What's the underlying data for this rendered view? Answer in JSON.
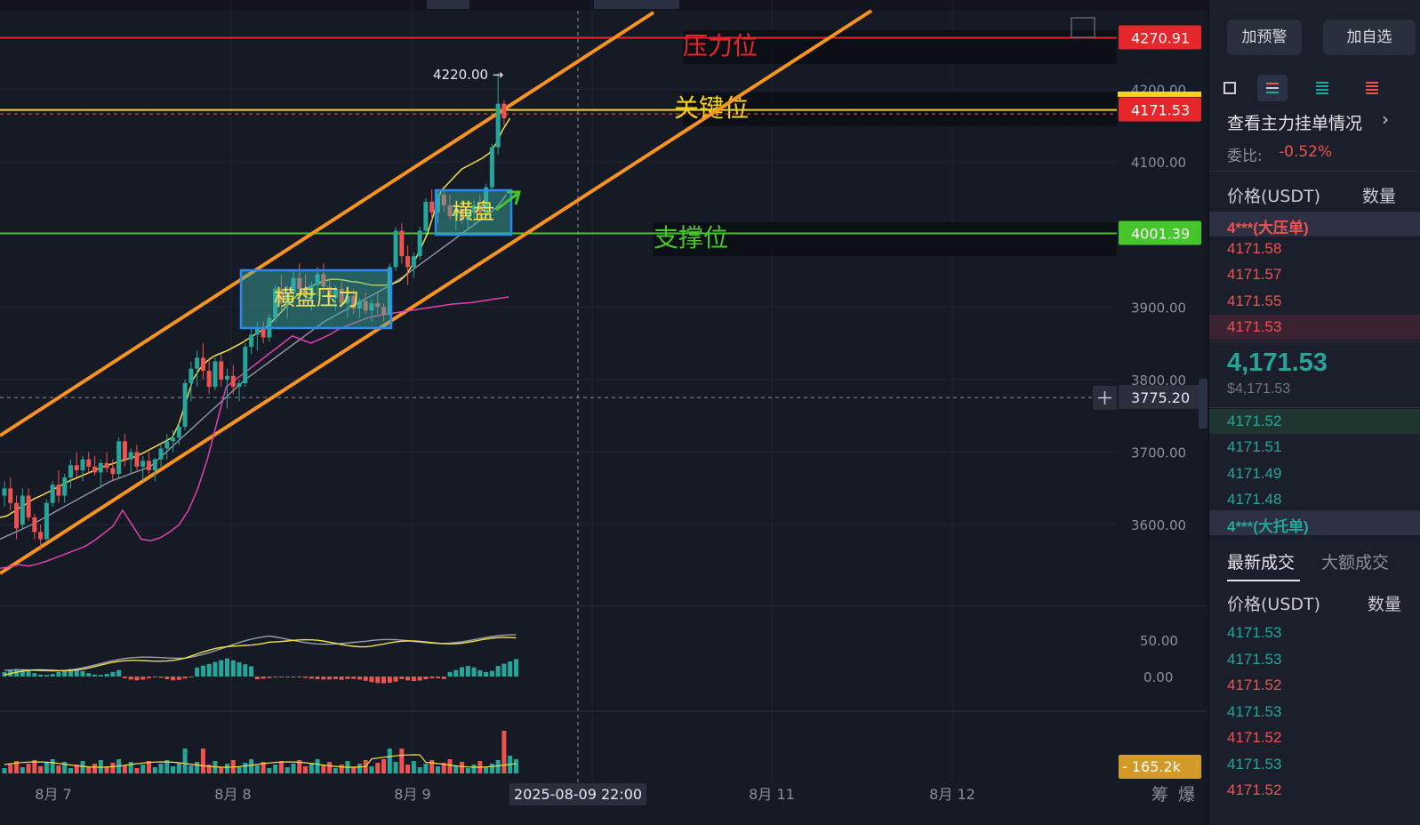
{
  "chart_data": {
    "type": "candlestick",
    "x_ticks": [
      "8月 7",
      "8月 8",
      "8月 9",
      "8月 11",
      "8月 12"
    ],
    "crosshair_time": "2025-08-09 22:00",
    "y_ticks": [
      "4200.00",
      "4100.00",
      "3900.00",
      "3800.00",
      "3700.00",
      "3600.00"
    ],
    "ylim": [
      3520,
      4320
    ],
    "price_tags": [
      {
        "label": "4270.91",
        "value": 4270.91,
        "color": "#e5262b"
      },
      {
        "label": "4171.53",
        "value": 4171.53,
        "color": "#e5262b"
      },
      {
        "label": "4001.39",
        "value": 4001.39,
        "color": "#46c52c"
      },
      {
        "label": "3775.20",
        "value": 3775.2,
        "color": "#2a2f3d"
      }
    ],
    "levels": [
      {
        "name": "压力位",
        "value": 4270.91,
        "color": "#e5262b"
      },
      {
        "name": "关键位",
        "value": 4171.53,
        "color": "#f4d21e"
      },
      {
        "name": "支撑位",
        "value": 4001.39,
        "color": "#46c52c"
      }
    ],
    "peak_label": "4220.00 →",
    "boxes": [
      {
        "label": "横盘压力"
      },
      {
        "label": "横盘"
      }
    ],
    "candles": [
      [
        3640,
        3660,
        3625,
        3650
      ],
      [
        3650,
        3665,
        3620,
        3630
      ],
      [
        3630,
        3640,
        3580,
        3595
      ],
      [
        3600,
        3650,
        3595,
        3640
      ],
      [
        3640,
        3650,
        3605,
        3610
      ],
      [
        3610,
        3615,
        3580,
        3590
      ],
      [
        3590,
        3600,
        3565,
        3580
      ],
      [
        3580,
        3635,
        3578,
        3630
      ],
      [
        3630,
        3660,
        3625,
        3655
      ],
      [
        3655,
        3675,
        3630,
        3640
      ],
      [
        3640,
        3670,
        3630,
        3665
      ],
      [
        3665,
        3690,
        3650,
        3682
      ],
      [
        3682,
        3700,
        3665,
        3675
      ],
      [
        3675,
        3695,
        3660,
        3690
      ],
      [
        3690,
        3700,
        3670,
        3680
      ],
      [
        3680,
        3695,
        3668,
        3672
      ],
      [
        3672,
        3690,
        3650,
        3685
      ],
      [
        3685,
        3700,
        3672,
        3678
      ],
      [
        3678,
        3690,
        3660,
        3670
      ],
      [
        3670,
        3720,
        3665,
        3715
      ],
      [
        3715,
        3725,
        3680,
        3690
      ],
      [
        3690,
        3705,
        3670,
        3700
      ],
      [
        3700,
        3710,
        3675,
        3680
      ],
      [
        3680,
        3695,
        3660,
        3688
      ],
      [
        3688,
        3700,
        3670,
        3675
      ],
      [
        3675,
        3692,
        3660,
        3690
      ],
      [
        3690,
        3710,
        3680,
        3705
      ],
      [
        3705,
        3725,
        3690,
        3715
      ],
      [
        3715,
        3730,
        3700,
        3720
      ],
      [
        3720,
        3740,
        3710,
        3735
      ],
      [
        3735,
        3800,
        3730,
        3795
      ],
      [
        3795,
        3825,
        3770,
        3815
      ],
      [
        3815,
        3840,
        3790,
        3830
      ],
      [
        3830,
        3850,
        3800,
        3812
      ],
      [
        3812,
        3830,
        3780,
        3790
      ],
      [
        3790,
        3830,
        3785,
        3825
      ],
      [
        3825,
        3835,
        3790,
        3800
      ],
      [
        3800,
        3815,
        3760,
        3805
      ],
      [
        3805,
        3820,
        3780,
        3790
      ],
      [
        3790,
        3800,
        3770,
        3795
      ],
      [
        3795,
        3850,
        3790,
        3845
      ],
      [
        3845,
        3870,
        3835,
        3862
      ],
      [
        3862,
        3880,
        3840,
        3870
      ],
      [
        3870,
        3880,
        3850,
        3858
      ],
      [
        3858,
        3890,
        3852,
        3885
      ],
      [
        3885,
        3930,
        3880,
        3925
      ],
      [
        3925,
        3945,
        3895,
        3905
      ],
      [
        3905,
        3930,
        3885,
        3920
      ],
      [
        3920,
        3950,
        3910,
        3940
      ],
      [
        3940,
        3960,
        3910,
        3925
      ],
      [
        3925,
        3945,
        3905,
        3915
      ],
      [
        3915,
        3935,
        3895,
        3930
      ],
      [
        3930,
        3955,
        3915,
        3945
      ],
      [
        3945,
        3960,
        3918,
        3928
      ],
      [
        3928,
        3940,
        3905,
        3912
      ],
      [
        3912,
        3930,
        3895,
        3925
      ],
      [
        3925,
        3935,
        3900,
        3905
      ],
      [
        3905,
        3920,
        3885,
        3915
      ],
      [
        3915,
        3925,
        3890,
        3898
      ],
      [
        3898,
        3912,
        3885,
        3908
      ],
      [
        3908,
        3920,
        3890,
        3895
      ],
      [
        3895,
        3910,
        3880,
        3905
      ],
      [
        3905,
        3920,
        3890,
        3900
      ],
      [
        3900,
        3905,
        3880,
        3890
      ],
      [
        3890,
        3960,
        3888,
        3955
      ],
      [
        3955,
        4010,
        3950,
        4005
      ],
      [
        4005,
        4015,
        3960,
        3970
      ],
      [
        3970,
        3985,
        3930,
        3955
      ],
      [
        3955,
        3975,
        3940,
        3970
      ],
      [
        3970,
        4010,
        3965,
        4005
      ],
      [
        4005,
        4050,
        3998,
        4045
      ],
      [
        4045,
        4062,
        4020,
        4030
      ],
      [
        4030,
        4060,
        4015,
        4055
      ],
      [
        4055,
        4062,
        4030,
        4040
      ],
      [
        4040,
        4055,
        4020,
        4025
      ],
      [
        4025,
        4040,
        4005,
        4035
      ],
      [
        4035,
        4048,
        4015,
        4020
      ],
      [
        4020,
        4035,
        4005,
        4030
      ],
      [
        4030,
        4048,
        4015,
        4040
      ],
      [
        4040,
        4055,
        4022,
        4030
      ],
      [
        4030,
        4070,
        4025,
        4065
      ],
      [
        4065,
        4125,
        4060,
        4120
      ],
      [
        4120,
        4222,
        4110,
        4180
      ],
      [
        4180,
        4185,
        4150,
        4160
      ]
    ],
    "macd": {
      "tick_labels": [
        "50.00",
        "0.00"
      ]
    },
    "volume": {
      "label": "165.2k"
    }
  },
  "right_panel": {
    "alert_button": "加预警",
    "watch_button": "加自选",
    "orderbook_link": "查看主力挂单情况",
    "ratio_label": "委比:",
    "ratio_value": "-0.52%",
    "price_header": "价格(USDT)",
    "qty_header": "数量",
    "ask_big": "4***(大压单)",
    "asks": [
      "4171.58",
      "4171.57",
      "4171.55",
      "4171.53"
    ],
    "last_price": "4,171.53",
    "last_price_usd": "$4,171.53",
    "bids": [
      "4171.52",
      "4171.51",
      "4171.49",
      "4171.48"
    ],
    "bid_big": "4***(大托单)",
    "tab_latest": "最新成交",
    "tab_large": "大额成交",
    "trades_price_header": "价格(USDT)",
    "trades_qty_header": "数量",
    "trades": [
      {
        "price": "4171.53",
        "side": "buy"
      },
      {
        "price": "4171.53",
        "side": "buy"
      },
      {
        "price": "4171.52",
        "side": "sell"
      },
      {
        "price": "4171.53",
        "side": "buy"
      },
      {
        "price": "4171.52",
        "side": "sell"
      },
      {
        "price": "4171.53",
        "side": "buy"
      },
      {
        "price": "4171.52",
        "side": "sell"
      }
    ]
  },
  "bottom_icons": [
    "筹",
    "爆"
  ],
  "colors": {
    "up": "#26a69a",
    "down": "#ef5350",
    "channel": "#f7931e",
    "ma_fast": "#f4e04d",
    "ma_slow": "#9aa0b0",
    "ma_long": "#e040b0"
  }
}
